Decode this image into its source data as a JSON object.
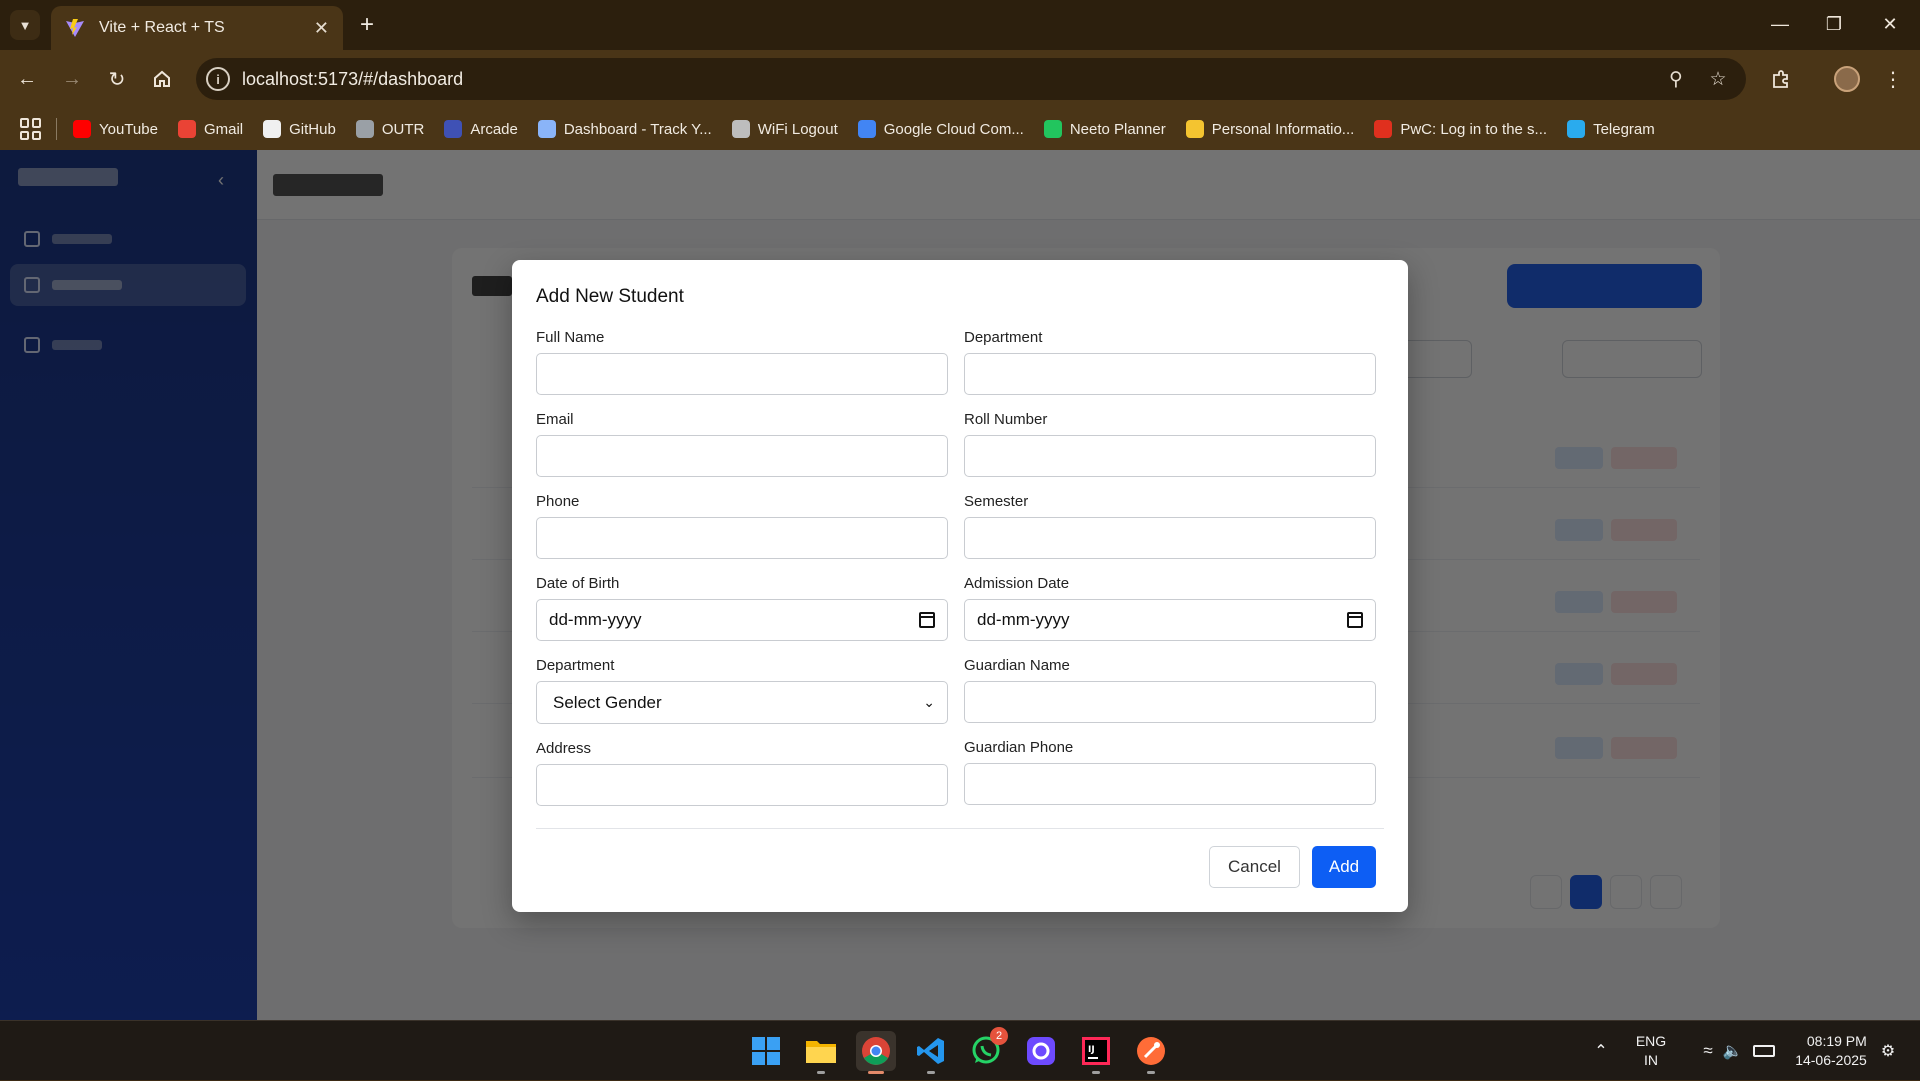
{
  "browser": {
    "tab_title": "Vite + React + TS",
    "url": "localhost:5173/#/dashboard",
    "bookmarks": [
      {
        "label": "YouTube",
        "icon": "youtube-icon",
        "color": "#ff0000"
      },
      {
        "label": "Gmail",
        "icon": "gmail-icon",
        "color": "#ea4335"
      },
      {
        "label": "GitHub",
        "icon": "github-icon",
        "color": "#f0f0f0"
      },
      {
        "label": "OUTR",
        "icon": "outr-icon",
        "color": "#9aa0a6"
      },
      {
        "label": "Arcade",
        "icon": "arcade-icon",
        "color": "#3f51b5"
      },
      {
        "label": "Dashboard - Track Y...",
        "icon": "dashboard-icon",
        "color": "#8ab4f8"
      },
      {
        "label": "WiFi Logout",
        "icon": "globe-icon",
        "color": "#bdbdbd"
      },
      {
        "label": "Google Cloud Com...",
        "icon": "google-cloud-icon",
        "color": "#4285f4"
      },
      {
        "label": "Neeto Planner",
        "icon": "neeto-icon",
        "color": "#22c55e"
      },
      {
        "label": "Personal Informatio...",
        "icon": "graduation-cap-icon",
        "color": "#f4c430"
      },
      {
        "label": "PwC: Log in to the s...",
        "icon": "pwc-icon",
        "color": "#e0301e"
      },
      {
        "label": "Telegram",
        "icon": "telegram-icon",
        "color": "#2aabee"
      }
    ]
  },
  "modal": {
    "title": "Add New Student",
    "fields_left": [
      {
        "label": "Full Name",
        "value": ""
      },
      {
        "label": "Email",
        "value": ""
      },
      {
        "label": "Phone",
        "value": ""
      },
      {
        "label": "Date of Birth",
        "value": "dd-mm-yyyy"
      },
      {
        "label": "Department",
        "value": "Select Gender"
      },
      {
        "label": "Address",
        "value": ""
      }
    ],
    "fields_right": [
      {
        "label": "Department",
        "value": ""
      },
      {
        "label": "Roll Number",
        "value": ""
      },
      {
        "label": "Semester",
        "value": ""
      },
      {
        "label": "Admission Date",
        "value": "dd-mm-yyyy"
      },
      {
        "label": "Guardian Name",
        "value": ""
      },
      {
        "label": "Guardian Phone",
        "value": ""
      }
    ],
    "cancel_label": "Cancel",
    "add_label": "Add"
  },
  "taskbar": {
    "language": "ENG",
    "region": "IN",
    "time": "08:19 PM",
    "date": "14-06-2025",
    "whatsapp_badge": "2"
  },
  "colors": {
    "primary": "#0d5ef4",
    "chrome": "#4a3517",
    "sidebar": "#1e3a8a"
  }
}
